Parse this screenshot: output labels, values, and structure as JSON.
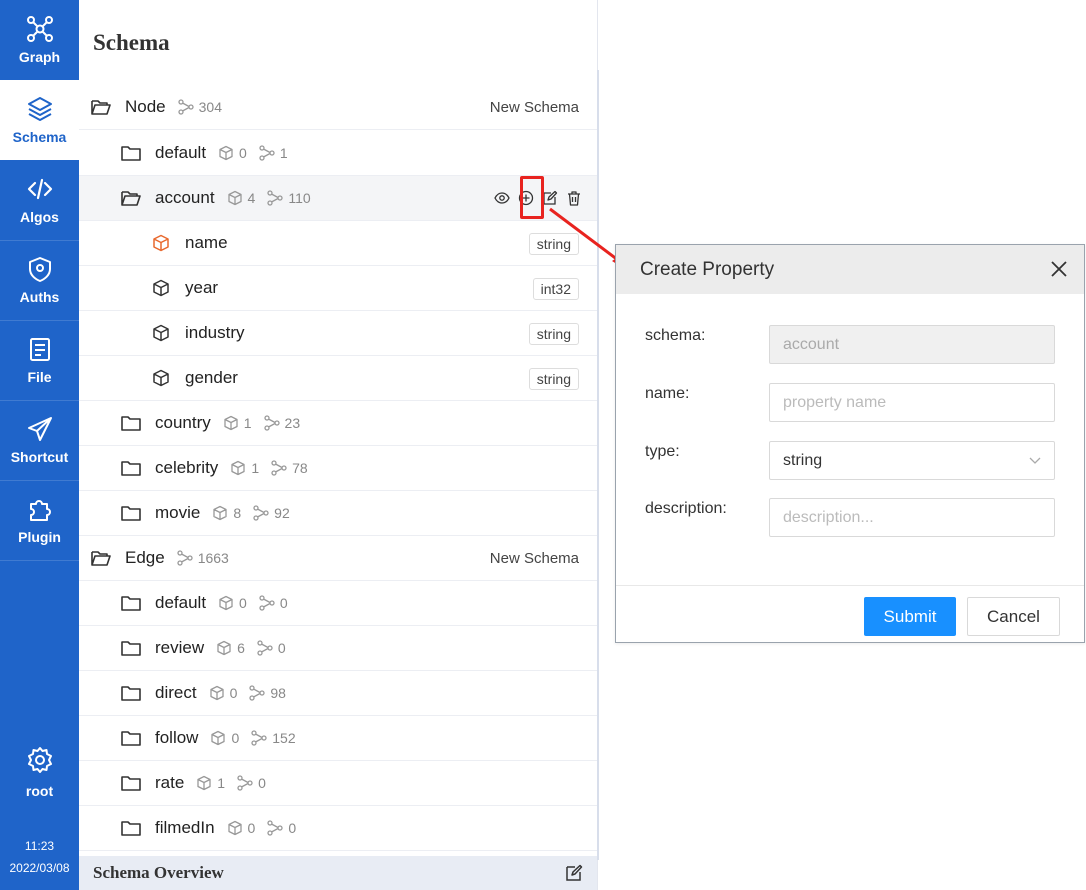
{
  "nav": {
    "items": [
      {
        "label": "Graph",
        "icon": "graph-icon"
      },
      {
        "label": "Schema",
        "icon": "layers-icon",
        "active": true
      },
      {
        "label": "Algos",
        "icon": "code-icon"
      },
      {
        "label": "Auths",
        "icon": "shield-icon"
      },
      {
        "label": "File",
        "icon": "file-icon"
      },
      {
        "label": "Shortcut",
        "icon": "paper-plane-icon"
      },
      {
        "label": "Plugin",
        "icon": "puzzle-icon"
      }
    ],
    "user": "root",
    "time": "11:23",
    "date": "2022/03/08"
  },
  "panel": {
    "title": "Schema",
    "node_group": {
      "label": "Node",
      "count": "304",
      "action": "New Schema"
    },
    "nodes": [
      {
        "name": "default",
        "props": "0",
        "count": "1"
      },
      {
        "name": "account",
        "props": "4",
        "count": "110",
        "expanded": true
      },
      {
        "name": "country",
        "props": "1",
        "count": "23"
      },
      {
        "name": "celebrity",
        "props": "1",
        "count": "78"
      },
      {
        "name": "movie",
        "props": "8",
        "count": "92"
      }
    ],
    "properties": [
      {
        "name": "name",
        "type": "string"
      },
      {
        "name": "year",
        "type": "int32"
      },
      {
        "name": "industry",
        "type": "string"
      },
      {
        "name": "gender",
        "type": "string"
      }
    ],
    "edge_group": {
      "label": "Edge",
      "count": "1663",
      "action": "New Schema"
    },
    "edges": [
      {
        "name": "default",
        "props": "0",
        "count": "0"
      },
      {
        "name": "review",
        "props": "6",
        "count": "0"
      },
      {
        "name": "direct",
        "props": "0",
        "count": "98"
      },
      {
        "name": "follow",
        "props": "0",
        "count": "152"
      },
      {
        "name": "rate",
        "props": "1",
        "count": "0"
      },
      {
        "name": "filmedIn",
        "props": "0",
        "count": "0"
      }
    ],
    "footer": "Schema Overview"
  },
  "dialog": {
    "title": "Create Property",
    "fields": {
      "schema_label": "schema:",
      "schema_value": "account",
      "name_label": "name:",
      "name_placeholder": "property name",
      "type_label": "type:",
      "type_value": "string",
      "description_label": "description:",
      "description_placeholder": "description..."
    },
    "submit": "Submit",
    "cancel": "Cancel"
  },
  "colors": {
    "nav": "#1f64c9",
    "primary": "#1890ff",
    "highlight": "#e8231f",
    "property_first_icon": "#e8692e"
  }
}
